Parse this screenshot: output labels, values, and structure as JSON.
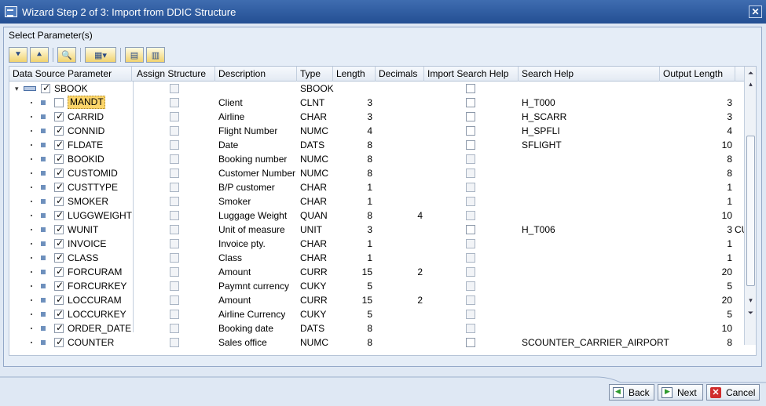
{
  "window": {
    "title": "Wizard Step 2 of 3: Import from DDIC Structure",
    "close_label": "✕"
  },
  "panel": {
    "title": "Select Parameter(s)"
  },
  "toolbar": {
    "buttons": [
      {
        "name": "expand-all-button",
        "glyph": "⯆"
      },
      {
        "name": "collapse-all-button",
        "glyph": "⯅"
      },
      {
        "name": "find-button",
        "glyph": "🔍"
      },
      {
        "name": "layout-menu-button",
        "glyph": "▦▾"
      },
      {
        "name": "select-all-button",
        "glyph": "▤"
      },
      {
        "name": "deselect-all-button",
        "glyph": "▥"
      }
    ]
  },
  "columns": {
    "param": "Data Source Parameter",
    "assign": "Assign Structure",
    "desc": "Description",
    "type": "Type",
    "length": "Length",
    "decimals": "Decimals",
    "ish": "Import Search Help",
    "sh": "Search Help",
    "outlen": "Output Length"
  },
  "root": {
    "name": "SBOOK",
    "type": "SBOOK",
    "checked": true
  },
  "rows": [
    {
      "name": "MANDT",
      "checked": false,
      "selected": true,
      "desc": "Client",
      "type": "CLNT",
      "length": "3",
      "decimals": "",
      "ish_enabled": true,
      "sh": "H_T000",
      "outlen": "3",
      "extra": ""
    },
    {
      "name": "CARRID",
      "checked": true,
      "desc": "Airline",
      "type": "CHAR",
      "length": "3",
      "decimals": "",
      "ish_enabled": true,
      "sh": "H_SCARR",
      "outlen": "3",
      "extra": ""
    },
    {
      "name": "CONNID",
      "checked": true,
      "desc": "Flight Number",
      "type": "NUMC",
      "length": "4",
      "decimals": "",
      "ish_enabled": true,
      "sh": "H_SPFLI",
      "outlen": "4",
      "extra": ""
    },
    {
      "name": "FLDATE",
      "checked": true,
      "desc": "Date",
      "type": "DATS",
      "length": "8",
      "decimals": "",
      "ish_enabled": true,
      "sh": "SFLIGHT",
      "outlen": "10",
      "extra": ""
    },
    {
      "name": "BOOKID",
      "checked": true,
      "desc": "Booking number",
      "type": "NUMC",
      "length": "8",
      "decimals": "",
      "ish_enabled": false,
      "sh": "",
      "outlen": "8",
      "extra": ""
    },
    {
      "name": "CUSTOMID",
      "checked": true,
      "desc": "Customer Number",
      "type": "NUMC",
      "length": "8",
      "decimals": "",
      "ish_enabled": false,
      "sh": "",
      "outlen": "8",
      "extra": ""
    },
    {
      "name": "CUSTTYPE",
      "checked": true,
      "desc": "B/P customer",
      "type": "CHAR",
      "length": "1",
      "decimals": "",
      "ish_enabled": false,
      "sh": "",
      "outlen": "1",
      "extra": ""
    },
    {
      "name": "SMOKER",
      "checked": true,
      "desc": "Smoker",
      "type": "CHAR",
      "length": "1",
      "decimals": "",
      "ish_enabled": false,
      "sh": "",
      "outlen": "1",
      "extra": ""
    },
    {
      "name": "LUGGWEIGHT",
      "checked": true,
      "desc": "Luggage Weight",
      "type": "QUAN",
      "length": "8",
      "decimals": "4",
      "ish_enabled": false,
      "sh": "",
      "outlen": "10",
      "extra": ""
    },
    {
      "name": "WUNIT",
      "checked": true,
      "desc": "Unit of measure",
      "type": "UNIT",
      "length": "3",
      "decimals": "",
      "ish_enabled": true,
      "sh": "H_T006",
      "outlen": "3",
      "extra": "CU"
    },
    {
      "name": "INVOICE",
      "checked": true,
      "desc": "Invoice pty.",
      "type": "CHAR",
      "length": "1",
      "decimals": "",
      "ish_enabled": false,
      "sh": "",
      "outlen": "1",
      "extra": ""
    },
    {
      "name": "CLASS",
      "checked": true,
      "desc": "Class",
      "type": "CHAR",
      "length": "1",
      "decimals": "",
      "ish_enabled": false,
      "sh": "",
      "outlen": "1",
      "extra": ""
    },
    {
      "name": "FORCURAM",
      "checked": true,
      "desc": "Amount",
      "type": "CURR",
      "length": "15",
      "decimals": "2",
      "ish_enabled": false,
      "sh": "",
      "outlen": "20",
      "extra": ""
    },
    {
      "name": "FORCURKEY",
      "checked": true,
      "desc": "Paymnt currency",
      "type": "CUKY",
      "length": "5",
      "decimals": "",
      "ish_enabled": false,
      "sh": "",
      "outlen": "5",
      "extra": ""
    },
    {
      "name": "LOCCURAM",
      "checked": true,
      "desc": "Amount",
      "type": "CURR",
      "length": "15",
      "decimals": "2",
      "ish_enabled": false,
      "sh": "",
      "outlen": "20",
      "extra": ""
    },
    {
      "name": "LOCCURKEY",
      "checked": true,
      "desc": "Airline Currency",
      "type": "CUKY",
      "length": "5",
      "decimals": "",
      "ish_enabled": false,
      "sh": "",
      "outlen": "5",
      "extra": ""
    },
    {
      "name": "ORDER_DATE",
      "checked": true,
      "desc": "Booking date",
      "type": "DATS",
      "length": "8",
      "decimals": "",
      "ish_enabled": false,
      "sh": "",
      "outlen": "10",
      "extra": ""
    },
    {
      "name": "COUNTER",
      "checked": true,
      "desc": "Sales office",
      "type": "NUMC",
      "length": "8",
      "decimals": "",
      "ish_enabled": true,
      "sh": "SCOUNTER_CARRIER_AIRPORT",
      "outlen": "8",
      "extra": ""
    }
  ],
  "buttons": {
    "back": "Back",
    "next": "Next",
    "cancel": "Cancel"
  },
  "colors": {
    "title_bar": "#2a5597",
    "selected_cell": "#fbd56a",
    "panel_bg": "#e5edf7"
  }
}
